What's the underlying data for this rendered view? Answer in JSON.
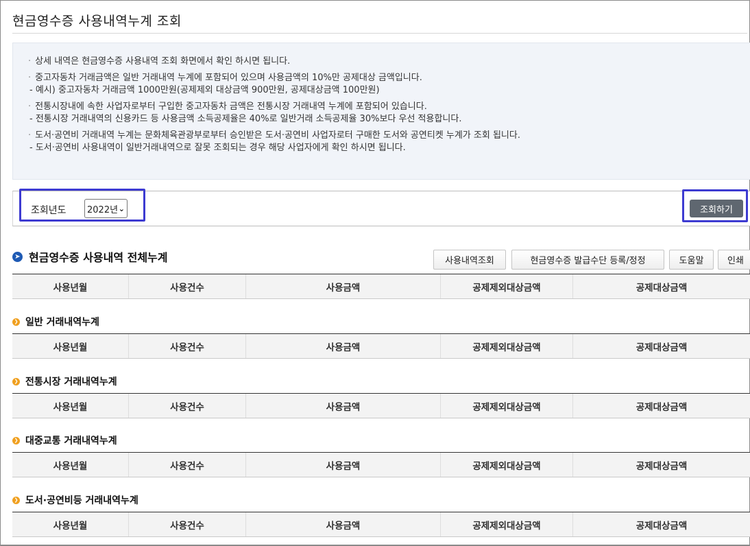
{
  "page": {
    "title": "현금영수증 사용내역누계 조회"
  },
  "notice": [
    {
      "main": "상세 내역은 현금영수증 사용내역 조회 화면에서 확인 하시면 됩니다.",
      "sub": ""
    },
    {
      "main": "중고자동차 거래금액은 일반 거래내역 누계에 포함되어 있으며 사용금액의 10%만 공제대상 금액입니다.",
      "sub": " - 예시) 중고자동차 거래금액 1000만원(공제제외 대상금액 900만원, 공제대상금액 100만원)"
    },
    {
      "main": "전통시장내에 속한 사업자로부터 구입한 중고자동차 금액은 전통시장 거래내역 누계에 포함되어 있습니다.",
      "sub": " - 전통시장 거래내역의 신용카드 등 사용금액 소득공제율은 40%로 일반거래 소득공제율 30%보다 우선 적용합니다."
    },
    {
      "main": "도서·공연비 거래내역 누계는 문화체육관광부로부터 승인받은 도서·공연비 사업자로터 구매한 도서와 공연티켓 누계가 조회 됩니다.",
      "sub": " - 도서·공연비 사용내역이 일반거래내역으로 잘못 조회되는 경우 해당 사업자에게 확인 하시면 됩니다."
    }
  ],
  "search": {
    "year_label": "조회년도",
    "year_value": "2022년",
    "button": "조회하기"
  },
  "summary": {
    "title": "현금영수증 사용내역 전체누계"
  },
  "buttons": {
    "usage": "사용내역조회",
    "register": "현금영수증 발급수단 등록/정정",
    "help": "도움말",
    "print": "인쇄"
  },
  "columns": [
    "사용년월",
    "사용건수",
    "사용금액",
    "공제제외대상금액",
    "공제대상금액"
  ],
  "sections": [
    {
      "title": "일반 거래내역누계"
    },
    {
      "title": "전통시장 거래내역누계"
    },
    {
      "title": "대중교통 거래내역누계"
    },
    {
      "title": "도서·공연비등 거래내역누계"
    }
  ],
  "colors": {
    "highlight": "#3d3bd1",
    "primary_button": "#5f6770",
    "section_icon": "#1e5ab4",
    "sub_icon": "#f0a020"
  }
}
